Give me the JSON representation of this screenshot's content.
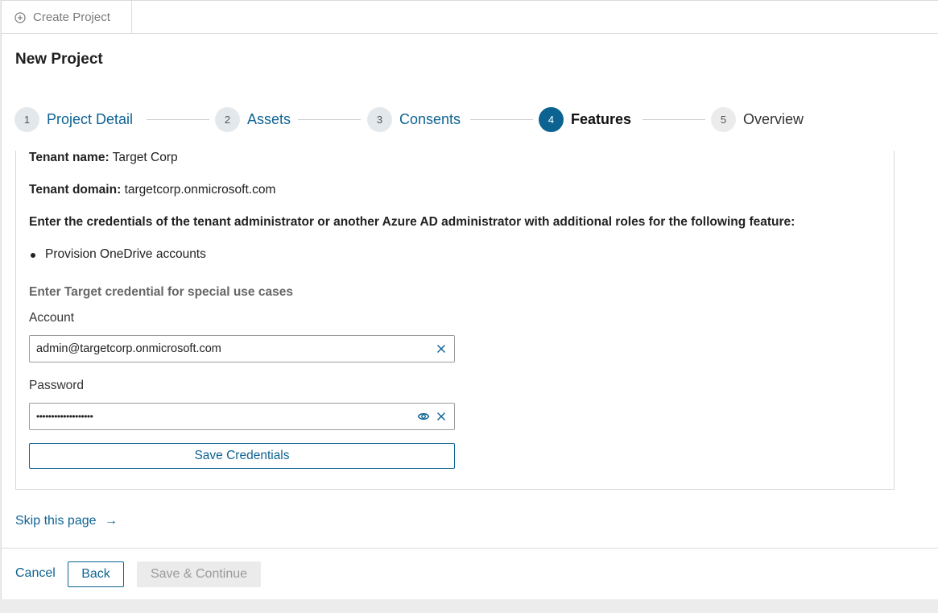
{
  "tab": {
    "label": "Create Project",
    "icon": "plus-circle-icon"
  },
  "page_title": "New Project",
  "steps": [
    {
      "number": "1",
      "label": "Project Detail",
      "state": "completed"
    },
    {
      "number": "2",
      "label": "Assets",
      "state": "completed"
    },
    {
      "number": "3",
      "label": "Consents",
      "state": "completed"
    },
    {
      "number": "4",
      "label": "Features",
      "state": "active"
    },
    {
      "number": "5",
      "label": "Overview",
      "state": "upcoming"
    }
  ],
  "content": {
    "tenant_name_label": "Tenant name:",
    "tenant_name": "Target Corp",
    "tenant_domain_label": "Tenant domain:",
    "tenant_domain": "targetcorp.onmicrosoft.com",
    "instructions": "Enter the credentials of the tenant administrator or another Azure AD administrator with additional roles for the following feature:",
    "features": [
      "Provision OneDrive accounts"
    ],
    "section_heading": "Enter Target credential for special use cases",
    "account": {
      "label": "Account",
      "value": "admin@targetcorp.onmicrosoft.com"
    },
    "password": {
      "label": "Password",
      "value": "•••••••••••••••••••"
    },
    "save_credentials_label": "Save Credentials"
  },
  "skip_label": "Skip this page",
  "skip_arrow": "→",
  "footer": {
    "cancel_label": "Cancel",
    "back_label": "Back",
    "save_continue_label": "Save & Continue"
  },
  "colors": {
    "accent": "#0e6393",
    "active_step": "#0c6391",
    "disabled_bg": "#ebebeb"
  }
}
